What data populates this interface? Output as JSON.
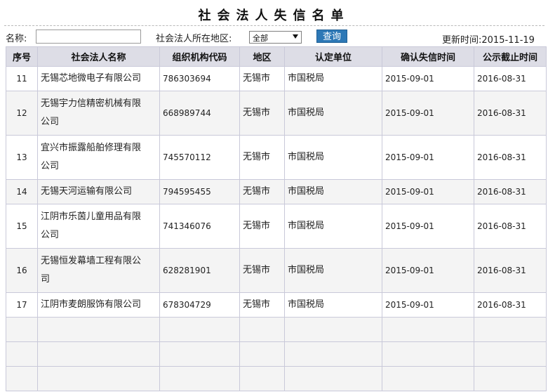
{
  "page": {
    "title": "社会法人失信名单"
  },
  "filters": {
    "name_label": "名称:",
    "name_value": "",
    "region_label": "社会法人所在地区:",
    "region_selected": "全部",
    "query_button": "查询",
    "update_label": "更新时间:",
    "update_date": "2015-11-19"
  },
  "table": {
    "columns": [
      "序号",
      "社会法人名称",
      "组织机构代码",
      "地区",
      "认定单位",
      "确认失信时间",
      "公示截止时间"
    ],
    "rows": [
      {
        "index": "11",
        "name_line1": "无锡芯地微电子有限公司",
        "name_line2": "",
        "code": "786303694",
        "region": "无锡市",
        "unit": "市国税局",
        "confirm": "2015-09-01",
        "deadline": "2016-08-31"
      },
      {
        "index": "12",
        "name_line1": "无锡宇力信精密机械有限",
        "name_line2": "公司",
        "code": "668989744",
        "region": "无锡市",
        "unit": "市国税局",
        "confirm": "2015-09-01",
        "deadline": "2016-08-31"
      },
      {
        "index": "13",
        "name_line1": "宜兴市振露船舶修理有限",
        "name_line2": "公司",
        "code": "745570112",
        "region": "无锡市",
        "unit": "市国税局",
        "confirm": "2015-09-01",
        "deadline": "2016-08-31"
      },
      {
        "index": "14",
        "name_line1": "无锡天河运输有限公司",
        "name_line2": "",
        "code": "794595455",
        "region": "无锡市",
        "unit": "市国税局",
        "confirm": "2015-09-01",
        "deadline": "2016-08-31"
      },
      {
        "index": "15",
        "name_line1": "江阴市乐茵儿童用品有限",
        "name_line2": "公司",
        "code": "741346076",
        "region": "无锡市",
        "unit": "市国税局",
        "confirm": "2015-09-01",
        "deadline": "2016-08-31"
      },
      {
        "index": "16",
        "name_line1": "无锡恒发幕墙工程有限公",
        "name_line2": "司",
        "code": "628281901",
        "region": "无锡市",
        "unit": "市国税局",
        "confirm": "2015-09-01",
        "deadline": "2016-08-31"
      },
      {
        "index": "17",
        "name_line1": "江阴市麦朗服饰有限公司",
        "name_line2": "",
        "code": "678304729",
        "region": "无锡市",
        "unit": "市国税局",
        "confirm": "2015-09-01",
        "deadline": "2016-08-31"
      }
    ]
  }
}
